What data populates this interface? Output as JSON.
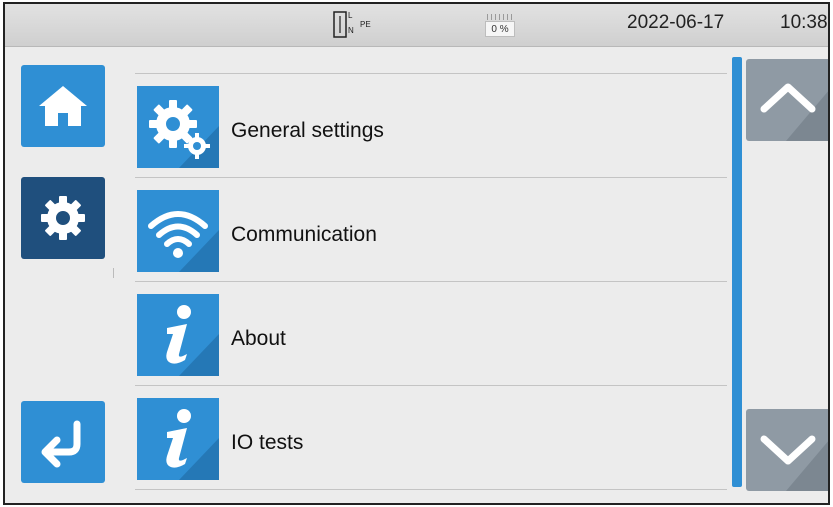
{
  "status_bar": {
    "wiring": {
      "l": "L",
      "n": "N",
      "pe": "PE"
    },
    "battery_text": "0 %",
    "date": "2022-06-17",
    "time": "10:38"
  },
  "nav": {
    "home_icon": "home-icon",
    "settings_icon": "gear-icon",
    "back_icon": "back-arrow-icon"
  },
  "menu": {
    "items": [
      {
        "label": "General settings",
        "icon": "gear-settings-icon"
      },
      {
        "label": "Communication",
        "icon": "wifi-icon"
      },
      {
        "label": "About",
        "icon": "info-icon"
      },
      {
        "label": "IO tests",
        "icon": "info-icon"
      }
    ]
  },
  "colors": {
    "accent": "#2f8fd4",
    "selected_nav": "#1f4f7d",
    "scroll_button": "#8f9aa4",
    "background": "#ececec"
  }
}
